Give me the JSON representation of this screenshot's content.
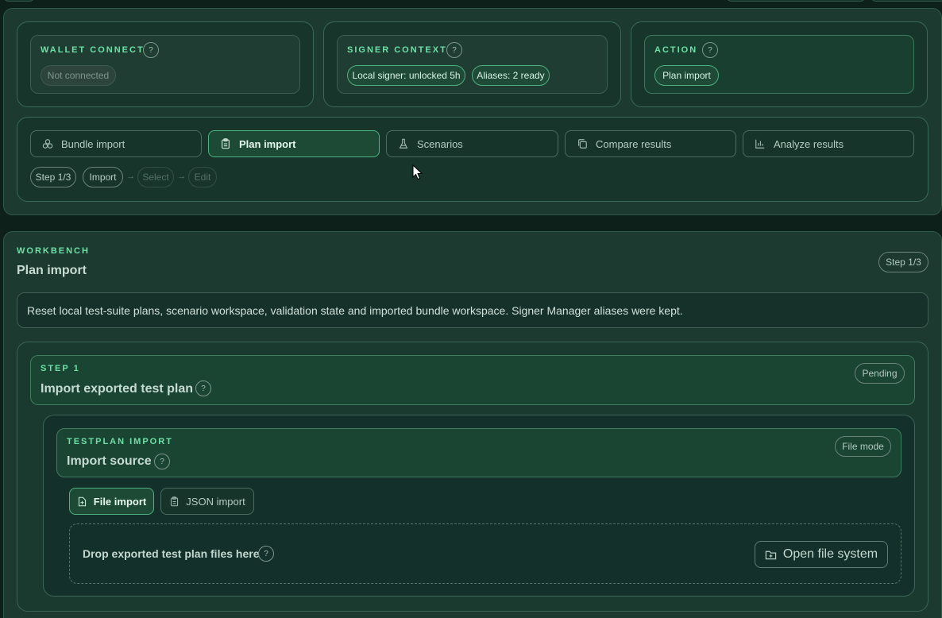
{
  "wallet": {
    "kicker": "WALLET CONNECT",
    "help": "?",
    "status": "Not connected"
  },
  "signer": {
    "kicker": "SIGNER CONTEXT",
    "help": "?",
    "chip1": "Local signer: unlocked 5h",
    "chip2": "Aliases: 2 ready"
  },
  "action": {
    "kicker": "ACTION",
    "help": "?",
    "chip": "Plan import"
  },
  "nav": {
    "items": [
      {
        "label": "Bundle import",
        "icon": "boxes-icon"
      },
      {
        "label": "Plan import",
        "icon": "clipboard-icon"
      },
      {
        "label": "Scenarios",
        "icon": "flask-icon"
      },
      {
        "label": "Compare results",
        "icon": "copy-icon"
      },
      {
        "label": "Analyze results",
        "icon": "bar-chart-icon"
      }
    ],
    "step": "Step 1/3",
    "crumbs": [
      "Import",
      "Select",
      "Edit"
    ],
    "arrow": "→"
  },
  "workbench": {
    "kicker": "WORKBENCH",
    "title": "Plan import",
    "step": "Step 1/3",
    "message": "Reset local test-suite plans, scenario workspace, validation state and imported bundle workspace. Signer Manager aliases were kept."
  },
  "step1": {
    "kicker": "STEP 1",
    "title": "Import exported test plan",
    "help": "?",
    "status": "Pending"
  },
  "testplan": {
    "kicker": "TESTPLAN IMPORT",
    "title": "Import source",
    "help": "?",
    "mode": "File mode",
    "file_tab": "File import",
    "json_tab": "JSON import",
    "drop_label": "Drop exported test plan files here",
    "drop_help": "?",
    "open_button": "Open file system"
  },
  "colors": {
    "accent": "#6ee0a6",
    "panel": "#1c3a30",
    "background": "#0d2019"
  }
}
